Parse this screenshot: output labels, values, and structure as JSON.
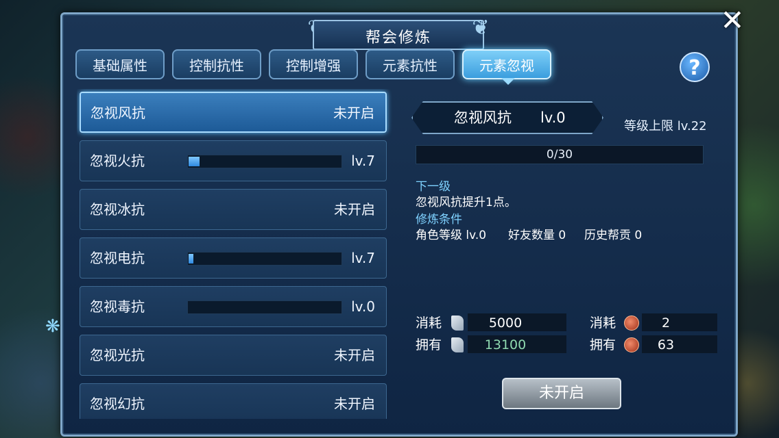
{
  "window": {
    "title": "帮会修炼"
  },
  "tabs": [
    {
      "label": "基础属性",
      "active": false
    },
    {
      "label": "控制抗性",
      "active": false
    },
    {
      "label": "控制增强",
      "active": false
    },
    {
      "label": "元素抗性",
      "active": false
    },
    {
      "label": "元素忽视",
      "active": true
    }
  ],
  "help": {
    "label": "?"
  },
  "close": {
    "label": "✕"
  },
  "list": [
    {
      "label": "忽视风抗",
      "status": "未开启",
      "progress": null
    },
    {
      "label": "忽视火抗",
      "status": "lv.7",
      "progress": 0.07
    },
    {
      "label": "忽视冰抗",
      "status": "未开启",
      "progress": null
    },
    {
      "label": "忽视电抗",
      "status": "lv.7",
      "progress": 0.03
    },
    {
      "label": "忽视毒抗",
      "status": "lv.0",
      "progress": 0
    },
    {
      "label": "忽视光抗",
      "status": "未开启",
      "progress": null
    },
    {
      "label": "忽视幻抗",
      "status": "未开启",
      "progress": null
    }
  ],
  "detail": {
    "name": "忽视风抗",
    "level": "lv.0",
    "cap": "等级上限 lv.22",
    "progress_text": "0/30",
    "progress": 0,
    "next_heading": "下一级",
    "next_text": "忽视风抗提升1点。",
    "cond_heading": "修炼条件",
    "cond_role": "角色等级 lv.0",
    "cond_friends": "好友数量 0",
    "cond_history": "历史帮贡 0"
  },
  "costs": {
    "consume_label": "消耗",
    "own_label": "拥有",
    "scroll_consume": "5000",
    "scroll_own": "13100",
    "coin_consume": "2",
    "coin_own": "63"
  },
  "action": {
    "label": "未开启"
  },
  "colors": {
    "accent": "#7fd2ff",
    "own_value": "#8fd9b0",
    "panel": "#16304f"
  }
}
